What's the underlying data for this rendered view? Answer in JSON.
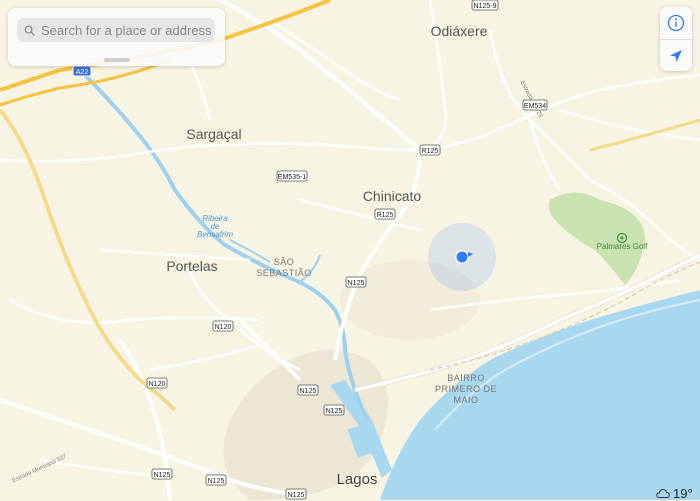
{
  "search": {
    "placeholder": "Search for a place or address"
  },
  "controls": {
    "info_icon": "info-icon",
    "location_icon": "location-arrow-icon"
  },
  "place_labels": {
    "odiaxere": "Odiáxere",
    "sargacal": "Sargaçal",
    "chinicato": "Chinicato",
    "portelas": "Portelas",
    "sao_sebastiao_1": "SÃO",
    "sao_sebastiao_2": "SEBASTIÃO",
    "bairro_1": "BAIRRO",
    "bairro_2": "PRIMERO DE",
    "bairro_3": "MAIO",
    "lagos": "Lagos",
    "ribeira_1": "Ribeira",
    "ribeira_2": "de",
    "ribeira_3": "Bensafrim",
    "palmares": "Palmares Golf",
    "estrada": "Estrada EN125",
    "municipal": "Estrada Municipal 537"
  },
  "road_shields": {
    "a22": "A22",
    "n125_9": "N125-9",
    "em534": "EM534",
    "r125_a": "R125",
    "em535_1": "EM535-1",
    "r125_b": "R125",
    "n125_a": "N125",
    "n120_a": "N120",
    "n120_b": "N120",
    "n125_b": "N125",
    "n125_c": "N125",
    "n125_d": "N125",
    "n125_e": "N125",
    "n125_f": "N125"
  },
  "weather": {
    "temperature": "19°",
    "icon": "cloud-icon"
  },
  "colors": {
    "land": "#f8f4e3",
    "water": "#a8d8f0",
    "river": "#9fd1ee",
    "park": "#c9e2b0",
    "highway": "#f6c343",
    "road": "#ffffff",
    "location": "#2f7cf6"
  }
}
